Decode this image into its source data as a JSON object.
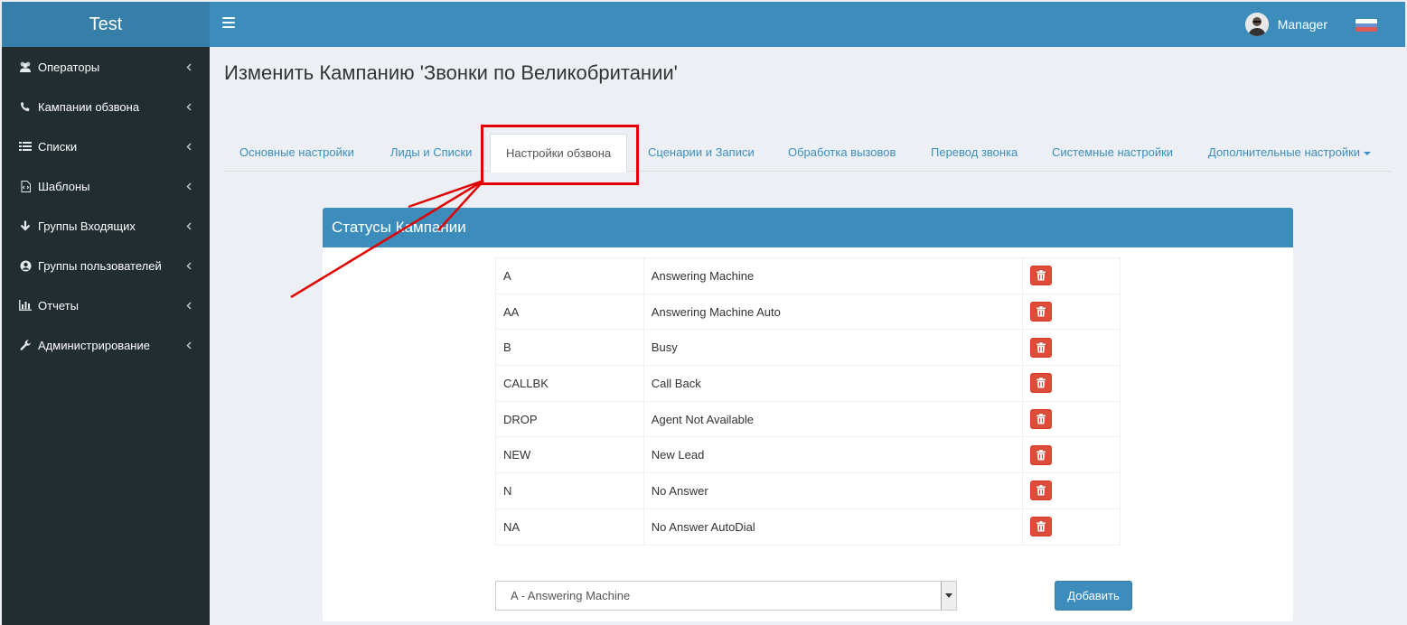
{
  "app": {
    "logo": "Test"
  },
  "header": {
    "user_name": "Manager"
  },
  "sidebar": {
    "items": [
      {
        "label": "Операторы",
        "icon": "users-icon"
      },
      {
        "label": "Кампании обзвона",
        "icon": "phone-icon"
      },
      {
        "label": "Списки",
        "icon": "list-icon"
      },
      {
        "label": "Шаблоны",
        "icon": "file-code-icon"
      },
      {
        "label": "Группы Входящих",
        "icon": "arrow-down-icon"
      },
      {
        "label": "Группы пользователей",
        "icon": "user-circle-icon"
      },
      {
        "label": "Отчеты",
        "icon": "bar-chart-icon"
      },
      {
        "label": "Администрирование",
        "icon": "wrench-icon"
      }
    ]
  },
  "page": {
    "title": "Изменить Кампанию 'Звонки по Великобритании'"
  },
  "tabs": [
    {
      "label": "Основные настройки"
    },
    {
      "label": "Лиды и Списки"
    },
    {
      "label": "Настройки обзвона"
    },
    {
      "label": "Сценарии и Записи"
    },
    {
      "label": "Обработка вызовов"
    },
    {
      "label": "Перевод звонка"
    },
    {
      "label": "Системные настройки"
    },
    {
      "label": "Дополнительные настройки"
    }
  ],
  "active_tab": "Настройки обзвона",
  "panel": {
    "title": "Статусы Кампании",
    "statuses": [
      {
        "code": "A",
        "description": "Answering Machine"
      },
      {
        "code": "AA",
        "description": "Answering Machine Auto"
      },
      {
        "code": "B",
        "description": "Busy"
      },
      {
        "code": "CALLBK",
        "description": "Call Back"
      },
      {
        "code": "DROP",
        "description": "Agent Not Available"
      },
      {
        "code": "NEW",
        "description": "New Lead"
      },
      {
        "code": "N",
        "description": "No Answer"
      },
      {
        "code": "NA",
        "description": "No Answer AutoDial"
      }
    ],
    "select_value": "A - Answering Machine",
    "add_label": "Добавить"
  },
  "colors": {
    "header": "#3c8dbc",
    "logo_bg": "#367fa9",
    "sidebar": "#222d32",
    "delete": "#dd4b39",
    "annotation": "#e00000"
  }
}
